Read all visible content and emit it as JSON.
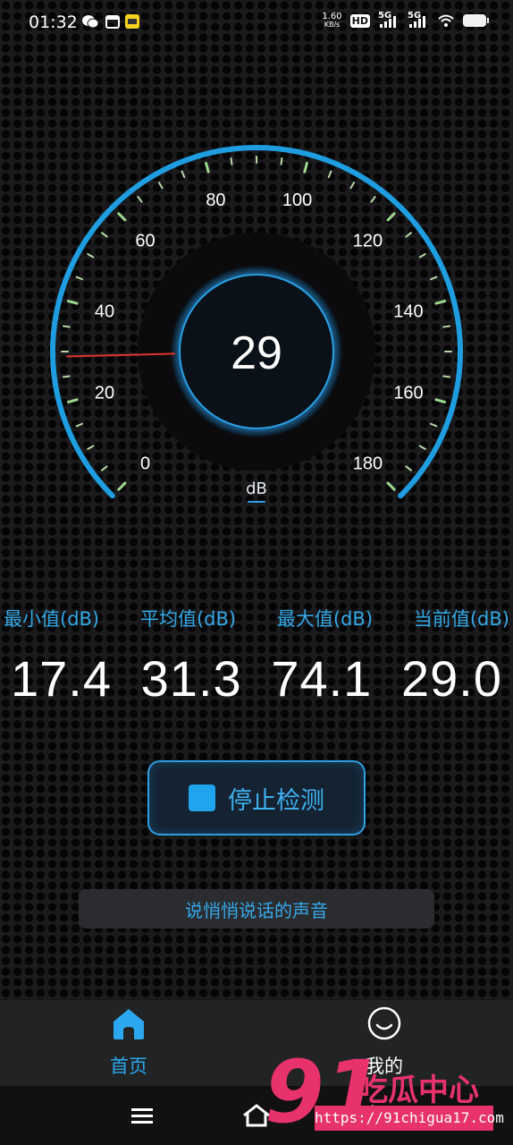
{
  "status_bar": {
    "time": "01:32",
    "net_speed": "1.60",
    "net_speed_unit": "KB/s",
    "hd_label": "HD",
    "sim1_label": "5G",
    "sim2_label": "5G"
  },
  "gauge": {
    "reading": "29",
    "unit": "dB",
    "value": 29,
    "range": [
      0,
      180
    ],
    "tick_labels": [
      "0",
      "20",
      "40",
      "60",
      "80",
      "100",
      "120",
      "140",
      "160",
      "180"
    ],
    "accent_color": "#1e9ee0",
    "needle_color": "#e2332e"
  },
  "stats": {
    "labels": [
      "最小值(dB)",
      "平均值(dB)",
      "最大值(dB)",
      "当前值(dB)"
    ],
    "values": [
      "17.4",
      "31.3",
      "74.1",
      "29.0"
    ]
  },
  "stop_button": {
    "label": "停止检测"
  },
  "hint": {
    "text": "说悄悄说话的声音"
  },
  "bottom_nav": {
    "items": [
      {
        "label": "首页",
        "icon": "home-icon",
        "active": true,
        "color": "#2aa7ee"
      },
      {
        "label": "我的",
        "icon": "smile-icon",
        "active": false,
        "color": "#ffffff"
      }
    ]
  },
  "watermark": {
    "brand": "91吃瓜中心",
    "url": "https://91chigua17.com"
  }
}
